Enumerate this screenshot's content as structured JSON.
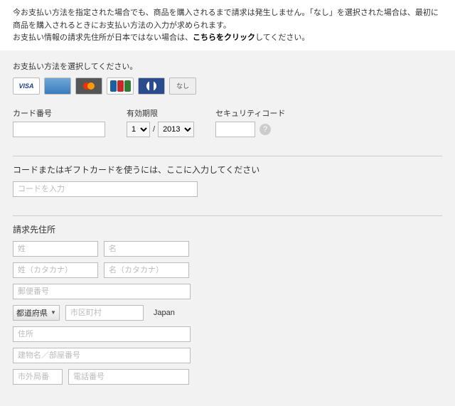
{
  "intro": {
    "line1": "今お支払い方法を指定された場合でも、商品を購入されるまで請求は発生しません。「なし」を選択された場合は、最初に商品を購入されるときにお支払い方法の入力が求められます。",
    "line2_prefix": "お支払い情報の請求先住所が日本ではない場合は、",
    "line2_link": "こちらをクリック",
    "line2_suffix": "してください。"
  },
  "payment": {
    "heading": "お支払い方法を選択してください。",
    "cards": {
      "visa": "VISA",
      "none": "なし"
    },
    "fields": {
      "card_number_label": "カード番号",
      "expiry_label": "有効期限",
      "security_label": "セキュリティコード",
      "month": "1",
      "year": "2013",
      "slash": "/"
    }
  },
  "gift": {
    "heading": "コードまたはギフトカードを使うには、ここに入力してください",
    "placeholder": "コードを入力"
  },
  "billing": {
    "heading": "請求先住所",
    "placeholders": {
      "last_name": "姓",
      "first_name": "名",
      "last_kana": "姓（カタカナ）",
      "first_kana": "名（カタカナ）",
      "postal": "郵便番号",
      "city": "市区町村",
      "address": "住所",
      "building": "建物名／部屋番号",
      "area_code": "市外局番",
      "phone": "電話番号"
    },
    "prefecture": "都道府県",
    "country": "Japan"
  }
}
